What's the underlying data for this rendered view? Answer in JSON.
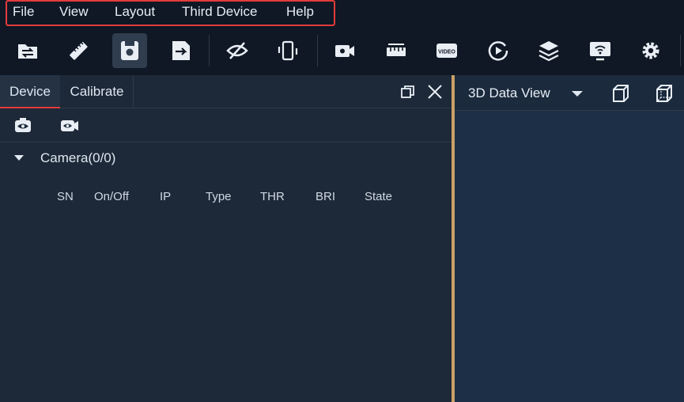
{
  "menu": {
    "items": [
      "File",
      "View",
      "Layout",
      "Third Device",
      "Help"
    ]
  },
  "toolbar": {
    "icons": [
      "open-folder-icon",
      "ruler-icon",
      "save-icon",
      "save-as-icon",
      "hide-icon",
      "rotate-device-icon",
      "camera-settings-icon",
      "measure-icon",
      "video-icon",
      "replay-icon",
      "layers-icon",
      "wifi-monitor-icon",
      "gear-icon"
    ],
    "video_label": "VIDEO"
  },
  "left_panel": {
    "tabs": [
      "Device",
      "Calibrate"
    ],
    "camera_group": "Camera(0/0)",
    "columns": [
      "SN",
      "On/Off",
      "IP",
      "Type",
      "THR",
      "BRI",
      "State"
    ]
  },
  "right_panel": {
    "title": "3D Data View"
  },
  "colors": {
    "background": "#0f1824",
    "panel": "#1d2938",
    "view_area": "#1d2f46",
    "highlight": "#e33b3b",
    "splitter": "#caa067"
  }
}
